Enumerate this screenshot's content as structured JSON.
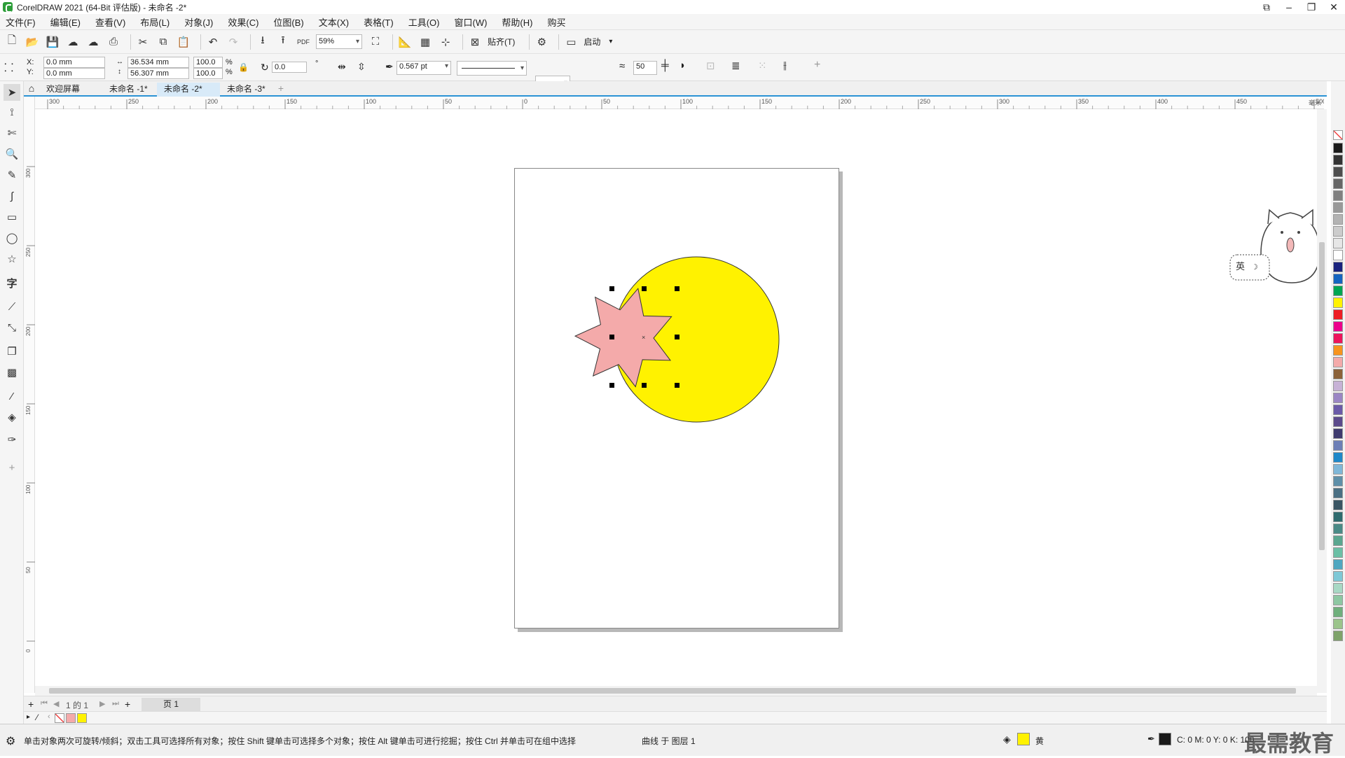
{
  "window": {
    "title": "CorelDRAW 2021 (64-Bit 评估版) - 未命名 -2*"
  },
  "menu": [
    "文件(F)",
    "编辑(E)",
    "查看(V)",
    "布局(L)",
    "对象(J)",
    "效果(C)",
    "位图(B)",
    "文本(X)",
    "表格(T)",
    "工具(O)",
    "窗口(W)",
    "帮助(H)",
    "购买"
  ],
  "toolbar": {
    "zoom": "59%",
    "snap_label": "贴齐(T)",
    "launch_label": "启动"
  },
  "properties": {
    "x_label": "X:",
    "x_value": "0.0 mm",
    "y_label": "Y:",
    "y_value": "0.0 mm",
    "width_value": "36.534 mm",
    "height_value": "56.307 mm",
    "scale_w": "100.0",
    "scale_h": "100.0",
    "pct": "%",
    "rotation": "0.0",
    "degree": "°",
    "outline_width": "0.567 pt",
    "smooth": "50"
  },
  "tabs": [
    {
      "label": "欢迎屏幕",
      "active": false
    },
    {
      "label": "未命名 -1*",
      "active": false
    },
    {
      "label": "未命名 -2*",
      "active": true
    },
    {
      "label": "未命名 -3*",
      "active": false
    }
  ],
  "ruler": {
    "h_ticks": [
      "300",
      "250",
      "200",
      "150",
      "100",
      "50",
      "0",
      "50",
      "100",
      "150",
      "200",
      "250",
      "300",
      "350",
      "400",
      "450",
      "500"
    ],
    "h_unit": "毫米",
    "v_ticks": [
      "300",
      "250",
      "200",
      "150",
      "100",
      "50",
      "0"
    ]
  },
  "page_nav": {
    "page_pos": "1 的 1",
    "page_tab": "页 1"
  },
  "status": {
    "hint": "单击对象两次可旋转/倾斜；双击工具可选择所有对象；按住 Shift 键单击可选择多个对象；按住 Alt 键单击可进行挖掘；按住 Ctrl 并单击可在组中选择",
    "object_info": "曲线 于 图层 1",
    "fill_name": "黄",
    "outline_cmyk": "C: 0 M: 0 Y: 0 K: 100"
  },
  "watermark": "最需教育",
  "ime": {
    "label": "英"
  },
  "colors": {
    "accent": "#2a93d5",
    "circle_fill": "#fff200",
    "star_fill": "#f4aaaa",
    "palette": [
      "#1a1a1a",
      "#333333",
      "#4d4d4d",
      "#666666",
      "#808080",
      "#999999",
      "#b3b3b3",
      "#cccccc",
      "#e6e6e6",
      "#ffffff",
      "#1a237e",
      "#1565c0",
      "#00a651",
      "#fff200",
      "#ed1c24",
      "#ec008c",
      "#ed145b",
      "#f7941d",
      "#f4aaaa",
      "#8c6239",
      "#c7b2d6",
      "#9a86c4",
      "#6a5aa8",
      "#5b4a8b",
      "#3e3a6e",
      "#6d7fb6",
      "#1e88c9",
      "#7fb7d8",
      "#5e8fa8",
      "#4a6f83",
      "#3a5563",
      "#2e6b6e",
      "#4a8a86",
      "#5aa68f",
      "#6bbfa5",
      "#4fa7c0",
      "#7ec8d6",
      "#a8d8c4",
      "#8dc7a2",
      "#6faf7c",
      "#9bc48b",
      "#7ea36a"
    ]
  }
}
